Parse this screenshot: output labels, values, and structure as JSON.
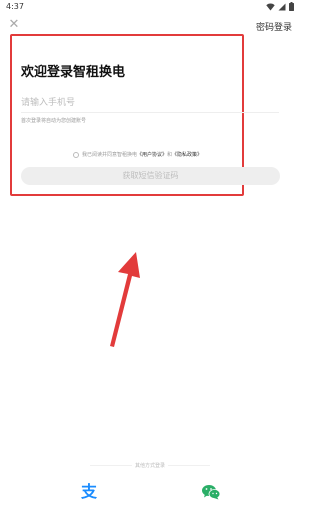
{
  "status_bar": {
    "time": "4:37"
  },
  "header": {
    "close_icon": "close-icon",
    "password_login": "密码登录"
  },
  "login": {
    "title": "欢迎登录智租换电",
    "phone_placeholder": "请输入手机号",
    "hint": "首次登录将自动为您创建账号",
    "agreement": {
      "prefix": "我已阅读并同意智租换电",
      "user_agreement": "《用户协议》",
      "and": "和",
      "privacy_policy": "《隐私政策》"
    },
    "sms_button": "获取短信验证码"
  },
  "other_login": {
    "label": "其他方式登录",
    "icons": [
      "alipay-icon",
      "wechat-icon"
    ]
  },
  "colors": {
    "highlight": "#e23b3b",
    "alipay": "#1a8cff",
    "wechat": "#2aae67"
  }
}
